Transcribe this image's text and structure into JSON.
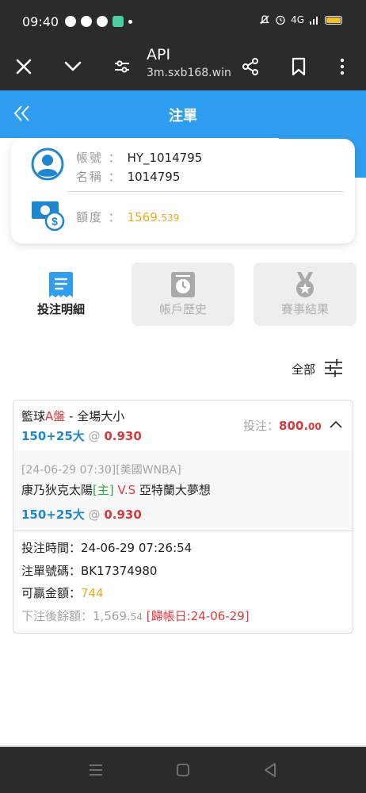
{
  "status": {
    "time": "09:40",
    "network": "4G"
  },
  "toolbar": {
    "title": "API",
    "url": "3m.sxb168.win"
  },
  "header": {
    "title": "注單"
  },
  "account": {
    "account_label": "帳號",
    "account_value": "HY_1014795",
    "name_label": "名稱",
    "name_value": "1014795",
    "credit_label": "額度",
    "credit_int": "1569.",
    "credit_dec": "539"
  },
  "tabs": [
    {
      "label": "投注明細",
      "active": true
    },
    {
      "label": "帳戶歷史",
      "active": false
    },
    {
      "label": "賽事結果",
      "active": false
    }
  ],
  "filter": {
    "label": "全部"
  },
  "bet": {
    "sport": "籃球",
    "market_a": "A盤",
    "market_rest": " - 全場大小",
    "selection": "150+25大",
    "at": "@",
    "odds": "0.930",
    "stake_label": "投注：",
    "stake_int": "800.",
    "stake_dec": "00",
    "event_info": "[24-06-29 07:30][美國WNBA]",
    "home_team": "康乃狄克太陽",
    "home_tag": "[主]",
    "vs": " V.S ",
    "away_team": "亞特蘭大夢想",
    "selection2": "150+25大",
    "odds2": "0.930",
    "bet_time": "投注時間：24-06-29 07:26:54",
    "bet_no": "注單號碼：BK17374980",
    "win_label": "可贏金額：",
    "win_value": "744",
    "balance_label": "下注後餘額：",
    "balance_int": "1,569.",
    "balance_dec": "54",
    "settle": "[歸帳日:24-06-29]"
  },
  "colors": {
    "accent": "#2f9ef0",
    "odds_red": "#d8393e",
    "credit_orange": "#f0a81c",
    "selection_blue": "#1f86cf"
  }
}
